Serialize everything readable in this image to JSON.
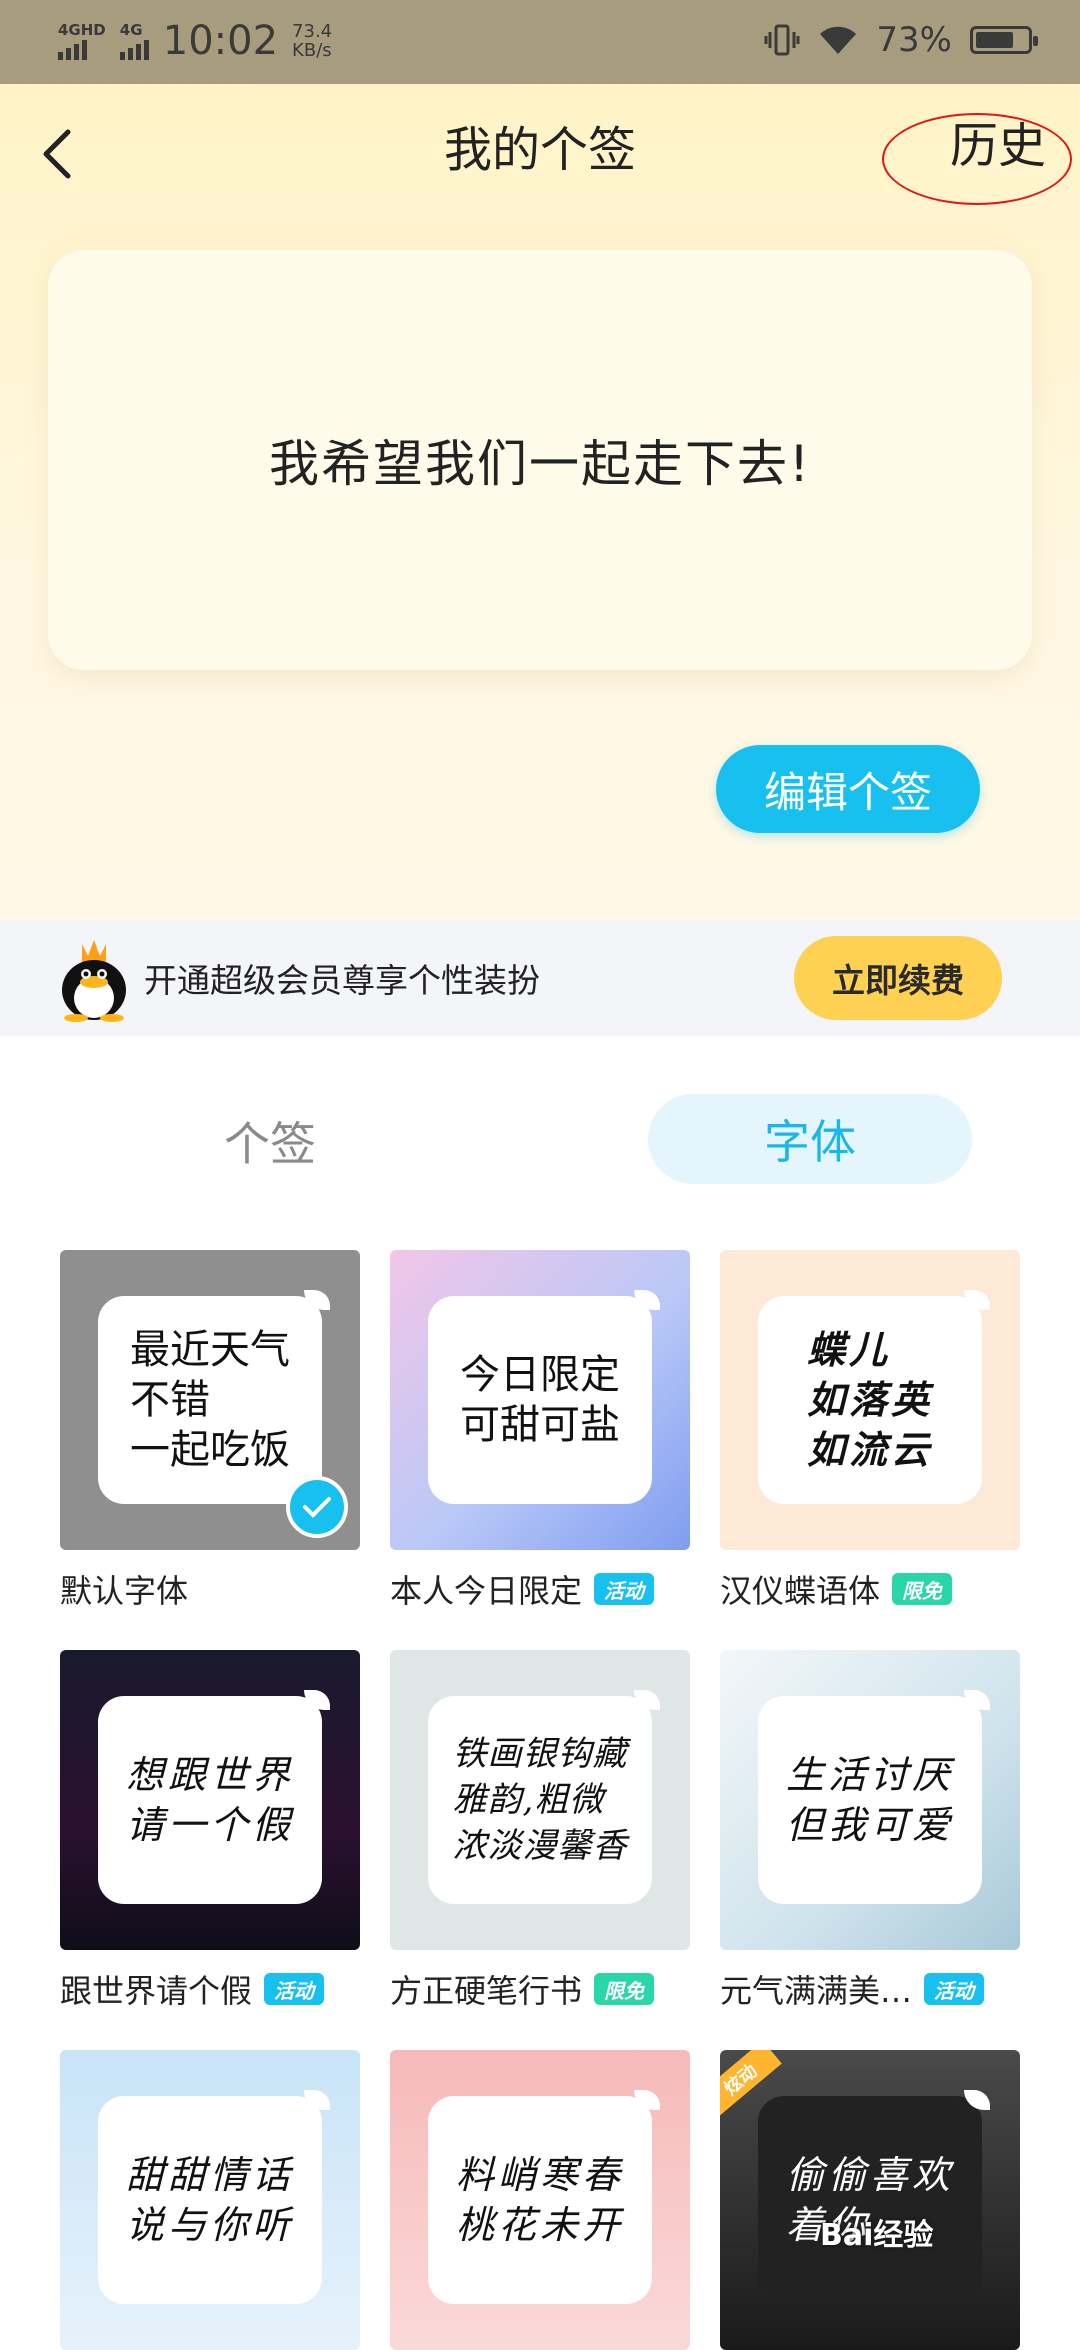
{
  "status_bar": {
    "net1": "4GHD",
    "net2": "4G",
    "time": "10:02",
    "speed_value": "73.4",
    "speed_unit": "KB/s",
    "battery": "73%",
    "battery_level": 0.73
  },
  "header": {
    "title": "我的个签",
    "history": "历史"
  },
  "signature": {
    "text": "我希望我们一起走下去!",
    "edit_button": "编辑个签"
  },
  "vip": {
    "text": "开通超级会员尊享个性装扮",
    "button": "立即续费"
  },
  "tabs": [
    {
      "label": "个签",
      "active": false
    },
    {
      "label": "字体",
      "active": true
    }
  ],
  "fonts": [
    {
      "name": "默认字体",
      "sample": "最近天气\n不错\n一起吃饭",
      "badge": "",
      "selected": true
    },
    {
      "name": "本人今日限定",
      "sample": "今日限定\n可甜可盐",
      "badge": "活动"
    },
    {
      "name": "汉仪蝶语体",
      "sample": "蝶儿\n如落英\n如流云",
      "badge": "限免"
    },
    {
      "name": "跟世界请个假",
      "sample": "想跟世界\n请一个假",
      "badge": "活动"
    },
    {
      "name": "方正硬笔行书",
      "sample": "铁画银钩藏\n雅韵,粗微\n浓淡漫馨香",
      "badge": "限免"
    },
    {
      "name": "元气满满美…",
      "sample": "生活讨厌\n但我可爱",
      "badge": "活动"
    },
    {
      "name": "",
      "sample": "甜甜情话\n说与你听",
      "badge": ""
    },
    {
      "name": "",
      "sample": "料峭寒春\n桃花未开",
      "badge": ""
    },
    {
      "name": "",
      "sample": "偷偷喜欢\n着你",
      "badge": "",
      "corner": "炫动"
    }
  ],
  "watermark": "Bai经验"
}
